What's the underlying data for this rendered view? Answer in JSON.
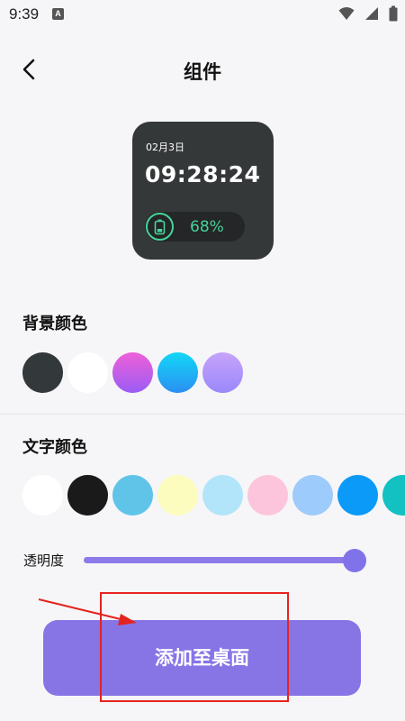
{
  "status_bar": {
    "time": "9:39",
    "notification_badge": "A",
    "icons": [
      "wifi-icon",
      "signal-icon",
      "battery-icon"
    ]
  },
  "header": {
    "back_icon": "chevron-left-icon",
    "title": "组件"
  },
  "widget_preview": {
    "date": "02月3日",
    "time": "09:28:24",
    "battery_icon": "battery-icon",
    "battery_percent": "68%",
    "battery_color": "#46d39a"
  },
  "background_color": {
    "label": "背景颜色",
    "swatches": [
      "#33383b",
      "#ffffff",
      "#c160f1",
      "#1ec2f4",
      "#b493fb"
    ]
  },
  "text_color": {
    "label": "文字颜色",
    "swatches": [
      "#ffffff",
      "#1a1a1a",
      "#60c4e8",
      "#fdfcbf",
      "#b3e5fa",
      "#fdc5db",
      "#9dcbfb",
      "#0b9af7",
      "#13c1c2"
    ]
  },
  "opacity": {
    "label": "透明度",
    "value": 0.97,
    "accent_color": "#8073e9"
  },
  "add_button": {
    "label": "添加至桌面",
    "color": "#8775e6"
  },
  "annotation_color": "#e5231e"
}
